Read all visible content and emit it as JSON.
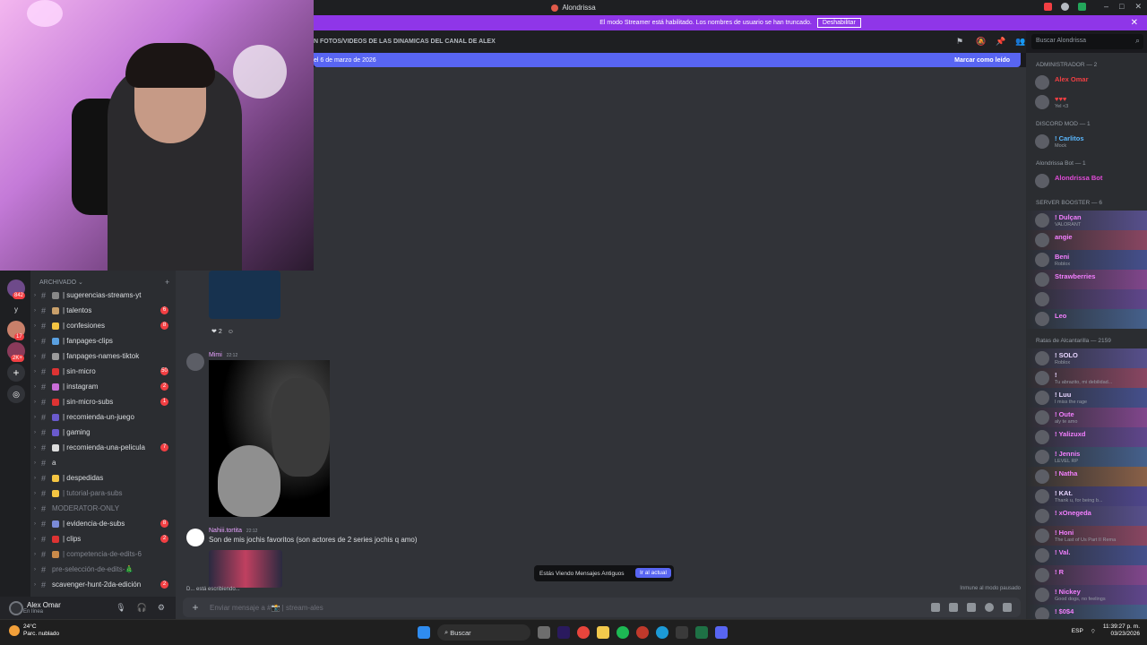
{
  "window": {
    "title": "Alondrissa"
  },
  "streamer_banner": {
    "text": "El modo Streamer está habilitado. Los nombres de usuario se han truncado.",
    "button": "Deshabilitar"
  },
  "header": {
    "channel_topic": "N FOTOS/VIDEOS DE LAS DINAMICAS DEL CANAL DE ALEX",
    "search_placeholder": "Buscar Alondrissa"
  },
  "new_messages_bar": {
    "text": "el 6 de marzo de 2026",
    "action": "Marcar como leído"
  },
  "channels": {
    "category": "ARCHIVADO",
    "items": [
      {
        "label": "| sugerencias-streams-yt",
        "count": "",
        "muted": false
      },
      {
        "label": "| talentos",
        "count": "6",
        "muted": false
      },
      {
        "label": "| confesiones",
        "count": "8",
        "muted": false
      },
      {
        "label": "| fanpages-clips",
        "count": "",
        "muted": false
      },
      {
        "label": "| fanpages-names-tiktok",
        "count": "",
        "muted": false
      },
      {
        "label": "| sin-micro",
        "count": "50",
        "muted": false
      },
      {
        "label": "| instagram",
        "count": "2",
        "muted": false
      },
      {
        "label": "| sin-micro-subs",
        "count": "1",
        "muted": false
      },
      {
        "label": "| recomienda-un-juego",
        "count": "",
        "muted": false
      },
      {
        "label": "| gaming",
        "count": "",
        "muted": false
      },
      {
        "label": "| recomienda-una-pelicula",
        "count": "7",
        "muted": false
      },
      {
        "label": "a",
        "count": "",
        "muted": false
      },
      {
        "label": "| despedidas",
        "count": "",
        "muted": false
      },
      {
        "label": "| tutorial-para-subs",
        "count": "",
        "muted": true
      },
      {
        "label": "MODERATOR-ONLY",
        "count": "",
        "muted": true
      },
      {
        "label": "| evidencia-de-subs",
        "count": "8",
        "muted": false
      },
      {
        "label": "| clips",
        "count": "2",
        "muted": false
      },
      {
        "label": "| competencia-de-edits-6",
        "count": "",
        "muted": true
      },
      {
        "label": "pre-selección-de-edits-🎄",
        "count": "",
        "muted": true
      },
      {
        "label": "scavenger-hunt-2da-edición",
        "count": "2",
        "muted": false
      }
    ]
  },
  "guild_badges": [
    "842",
    "17",
    "2K+"
  ],
  "user_panel": {
    "name": "Alex Omar",
    "status": "En línea"
  },
  "messages": [
    {
      "author": "Mimi",
      "time": "22:12",
      "body": "",
      "reaction_count": "2"
    },
    {
      "author": "Nahiii.tortita",
      "time": "22:12",
      "body": "Son de mis jochis favoritos (son actores de 2 series jochis q amo)"
    }
  ],
  "typing": "D... está escribiendo...",
  "old_messages": {
    "text": "Estás Viendo Mensajes Antiguos",
    "button": "Ir al actual"
  },
  "paused": "Inmune al modo pausado",
  "composer": {
    "placeholder": "Enviar mensaje a #📸 | stream-ales"
  },
  "members": {
    "groups": [
      {
        "title": "ADMINISTRADOR — 2",
        "members": [
          {
            "name": "Alex Omar",
            "sub": "",
            "color": "#f23f43"
          },
          {
            "name": "♥♥♥",
            "sub": "Yel <3",
            "color": "#f23f43"
          }
        ]
      },
      {
        "title": "DISCORD MOD — 1",
        "members": [
          {
            "name": "! Carlitos",
            "sub": "Mock",
            "color": "#5ab8ff"
          }
        ]
      },
      {
        "title": "Alondrissa Bot — 1",
        "members": [
          {
            "name": "Alondrissa Bot",
            "sub": "",
            "color": "#e14bd8"
          }
        ]
      },
      {
        "title": "SERVER BOOSTER — 6",
        "members": [
          {
            "name": "! Dulçan",
            "sub": "VALORANT",
            "color": "#f47fff"
          },
          {
            "name": "angie",
            "sub": "",
            "color": "#f47fff"
          },
          {
            "name": "Beni",
            "sub": "Roblox",
            "color": "#f47fff"
          },
          {
            "name": "Strawberries",
            "sub": "",
            "color": "#f47fff"
          },
          {
            "name": "",
            "sub": "",
            "color": "#f47fff"
          },
          {
            "name": "Leo",
            "sub": "",
            "color": "#f47fff"
          }
        ]
      },
      {
        "title": "Ratas de Alcantarilla — 2159",
        "members": [
          {
            "name": "! SOLO",
            "sub": "Roblox",
            "color": "#e8d5ff"
          },
          {
            "name": "!",
            "sub": "Tu abrazito, mi debilidad...",
            "color": "#e8d5ff"
          },
          {
            "name": "! Luu",
            "sub": "I miss the rage",
            "color": "#e8d5ff"
          },
          {
            "name": "! Oute",
            "sub": "aly te amo",
            "color": "#f47fff"
          },
          {
            "name": "! Yalizuxd",
            "sub": "",
            "color": "#f47fff"
          },
          {
            "name": "! Jennis",
            "sub": "LEVEL RP",
            "color": "#f47fff"
          },
          {
            "name": "! Natha",
            "sub": "",
            "color": "#f47fff"
          },
          {
            "name": "! KAt.",
            "sub": "Thank u, for being b...",
            "color": "#e8d5ff"
          },
          {
            "name": "! xOnegeda",
            "sub": "",
            "color": "#f47fff"
          },
          {
            "name": "! Honi",
            "sub": "The Last of Us Part II Rema",
            "color": "#f47fff"
          },
          {
            "name": "! Val.",
            "sub": "",
            "color": "#f47fff"
          },
          {
            "name": "! R",
            "sub": "",
            "color": "#f47fff"
          },
          {
            "name": "! Nickey",
            "sub": "Good dogs, no feelings",
            "color": "#f47fff"
          },
          {
            "name": "! $0$4",
            "sub": "",
            "color": "#f47fff"
          }
        ]
      }
    ]
  },
  "taskbar": {
    "weather_temp": "24°C",
    "weather_desc": "Parc. nublado",
    "search": "Buscar",
    "lang": "ESP",
    "time": "11:39:27 p. m.",
    "date": "03/23/2026"
  },
  "colors": {
    "accent": "#5865f2",
    "streamer": "#8f36e8",
    "danger": "#f23f43"
  }
}
